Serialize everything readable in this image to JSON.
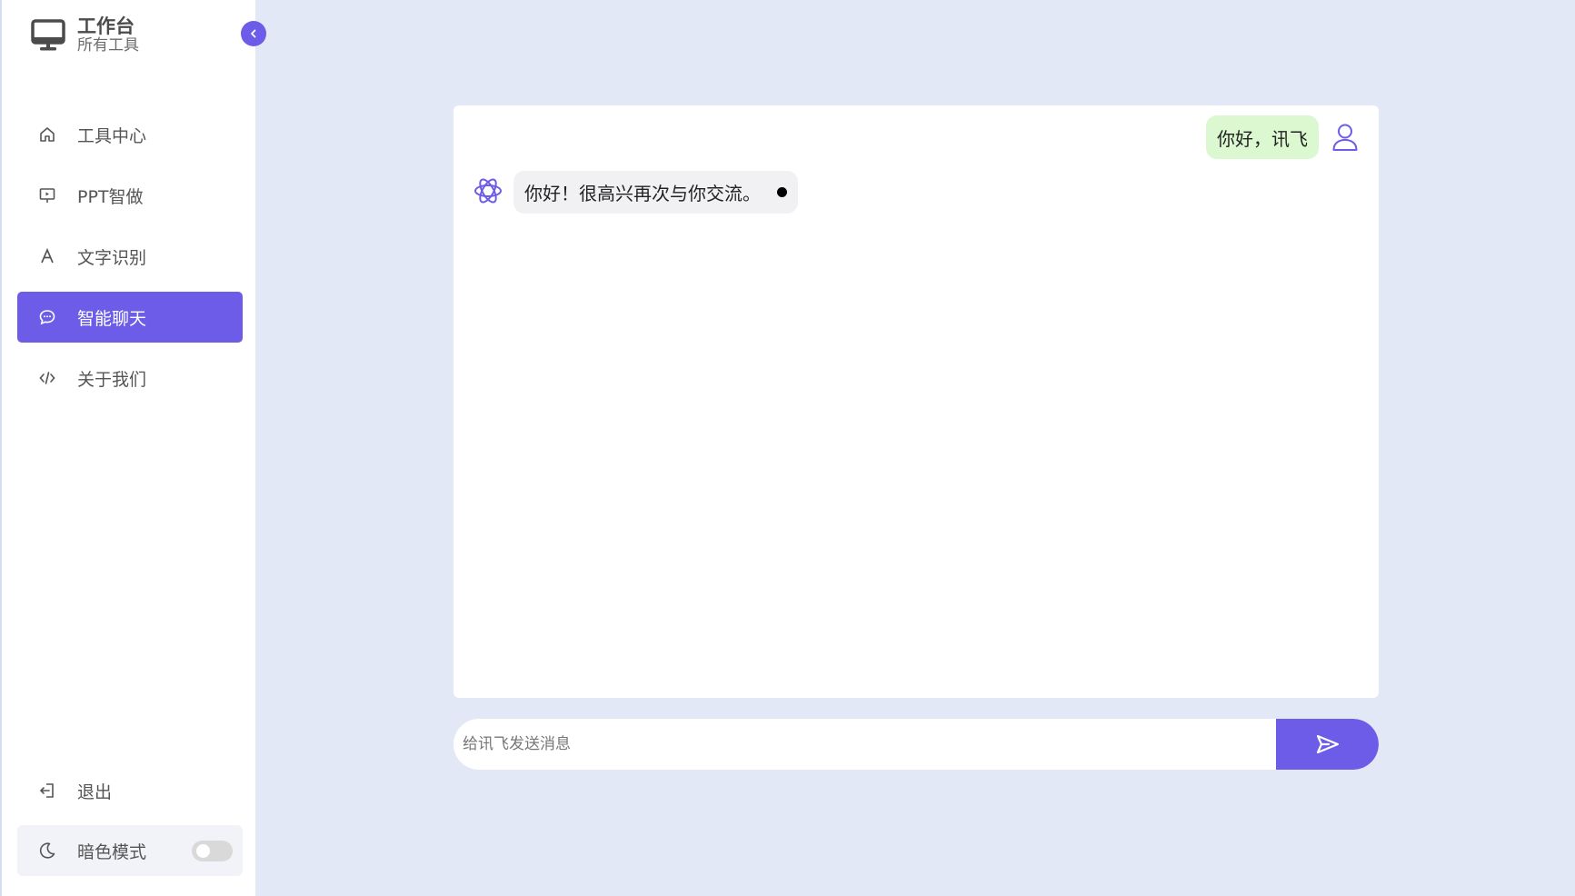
{
  "brand": {
    "title": "工作台",
    "subtitle": "所有工具",
    "icon": "monitor-icon"
  },
  "sidebar": {
    "collapse_icon": "chevron-left-icon",
    "items": [
      {
        "label": "工具中心",
        "icon": "home-icon",
        "active": false
      },
      {
        "label": "PPT智做",
        "icon": "presentation-icon",
        "active": false
      },
      {
        "label": "文字识别",
        "icon": "letter-a-icon",
        "active": false
      },
      {
        "label": "智能聊天",
        "icon": "chat-bubble-icon",
        "active": true
      },
      {
        "label": "关于我们",
        "icon": "code-icon",
        "active": false
      }
    ],
    "logout": {
      "label": "退出",
      "icon": "logout-icon"
    },
    "dark_mode": {
      "label": "暗色模式",
      "icon": "moon-icon",
      "enabled": false
    }
  },
  "chat": {
    "messages": [
      {
        "role": "user",
        "text": "你好，讯飞"
      },
      {
        "role": "assistant",
        "text": "你好！很高兴再次与你交流。",
        "streaming": true
      }
    ]
  },
  "composer": {
    "placeholder": "给讯飞发送消息",
    "value": "",
    "send_icon": "send-icon"
  },
  "colors": {
    "accent": "#6c5ce7",
    "background": "#e3e8f6",
    "user_bubble": "#dcf8d0",
    "bot_bubble": "#f1f1f3"
  }
}
